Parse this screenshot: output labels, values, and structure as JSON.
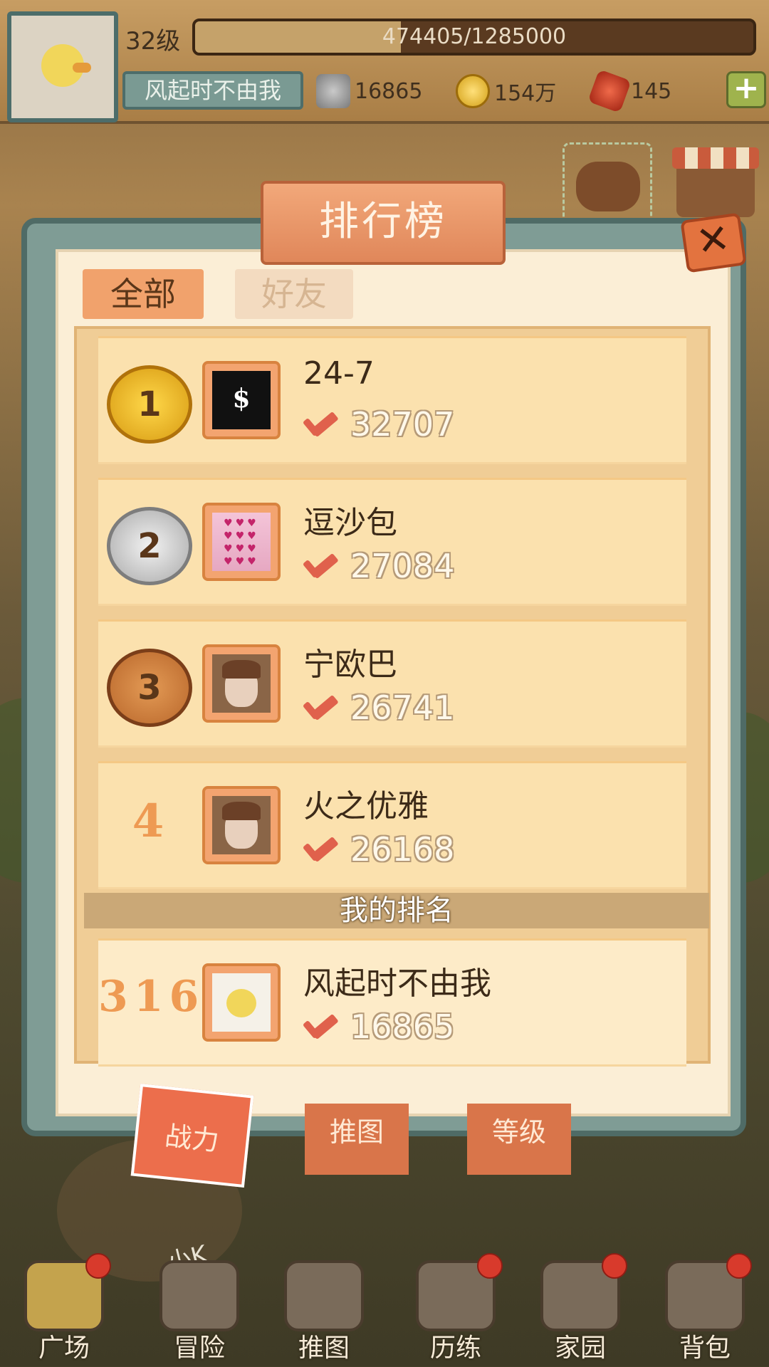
{
  "header": {
    "level": "32级",
    "exp_text": "474405/1285000",
    "exp_progress": 0.369,
    "player_name": "风起时不由我",
    "power": "16865",
    "gold": "154万",
    "gems": "145",
    "add_icon": "plus-icon"
  },
  "panel": {
    "title": "排行榜",
    "close_icon": "close-x-icon",
    "tabs": [
      {
        "label": "全部",
        "active": true
      },
      {
        "label": "好友",
        "active": false
      }
    ],
    "rows": [
      {
        "rank": "1",
        "name": "24-7",
        "power": "32707",
        "medal": "gold"
      },
      {
        "rank": "2",
        "name": "逗沙包",
        "power": "27084",
        "medal": "silver"
      },
      {
        "rank": "3",
        "name": "宁欧巴",
        "power": "26741",
        "medal": "bronze"
      },
      {
        "rank": "4",
        "name": "火之优雅",
        "power": "26168",
        "medal": "none"
      }
    ],
    "my_rank_title": "我的排名",
    "my_rank": {
      "rank": "316",
      "name": "风起时不由我",
      "power": "16865"
    },
    "ribbons": [
      "战力",
      "推图",
      "等级"
    ]
  },
  "hero_name": "小K",
  "nav": [
    {
      "label": "广场",
      "icon": "plaza-icon"
    },
    {
      "label": "冒险",
      "icon": "adventure-icon"
    },
    {
      "label": "推图",
      "icon": "map-push-icon"
    },
    {
      "label": "历练",
      "icon": "training-icon"
    },
    {
      "label": "家园",
      "icon": "home-icon"
    },
    {
      "label": "背包",
      "icon": "backpack-icon"
    }
  ],
  "colors": {
    "accent_orange": "#ec6e4c",
    "frame_teal": "#7f9c95",
    "sword_red": "#e0614c",
    "notify_red": "#d83a2c"
  }
}
